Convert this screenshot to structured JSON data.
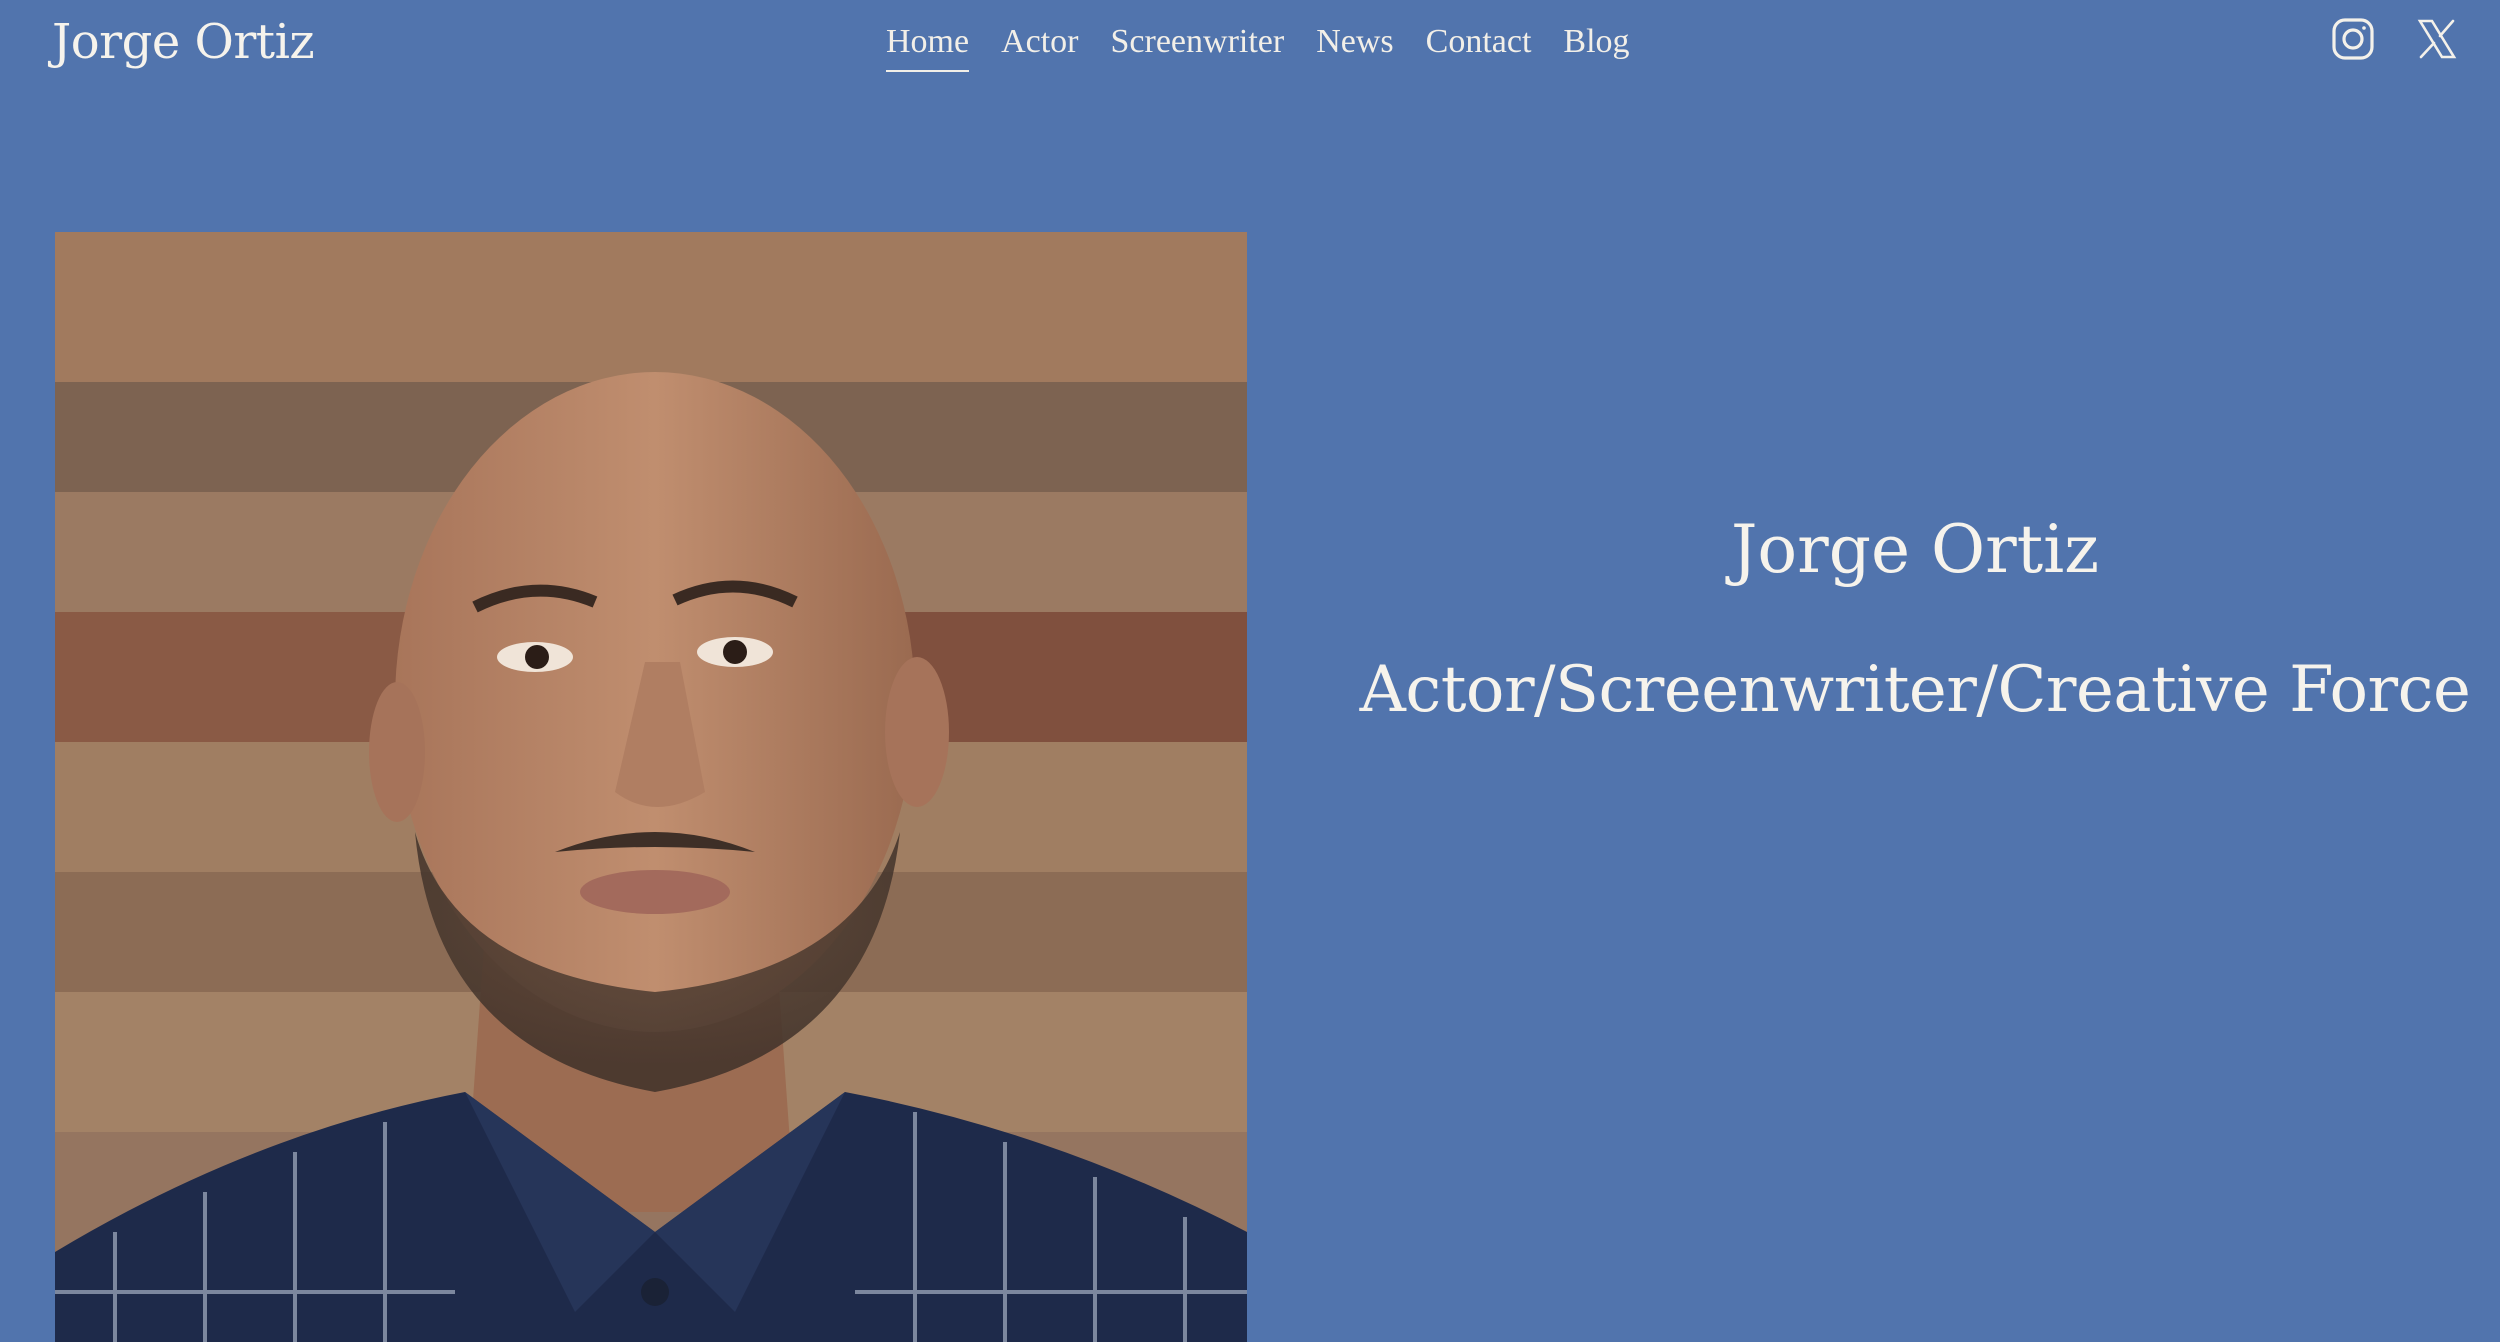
{
  "header": {
    "site_title": "Jorge Ortiz",
    "nav": [
      {
        "label": "Home",
        "active": true
      },
      {
        "label": "Actor",
        "active": false
      },
      {
        "label": "Screenwriter",
        "active": false
      },
      {
        "label": "News",
        "active": false
      },
      {
        "label": "Contact",
        "active": false
      },
      {
        "label": "Blog",
        "active": false
      }
    ],
    "social": [
      {
        "icon": "instagram-icon"
      },
      {
        "icon": "x-twitter-icon"
      }
    ]
  },
  "hero": {
    "name": "Jorge Ortiz",
    "tagline": "Actor/Screenwriter/Creative Force"
  },
  "colors": {
    "background": "#5174ad",
    "text": "#f4f1ea"
  }
}
